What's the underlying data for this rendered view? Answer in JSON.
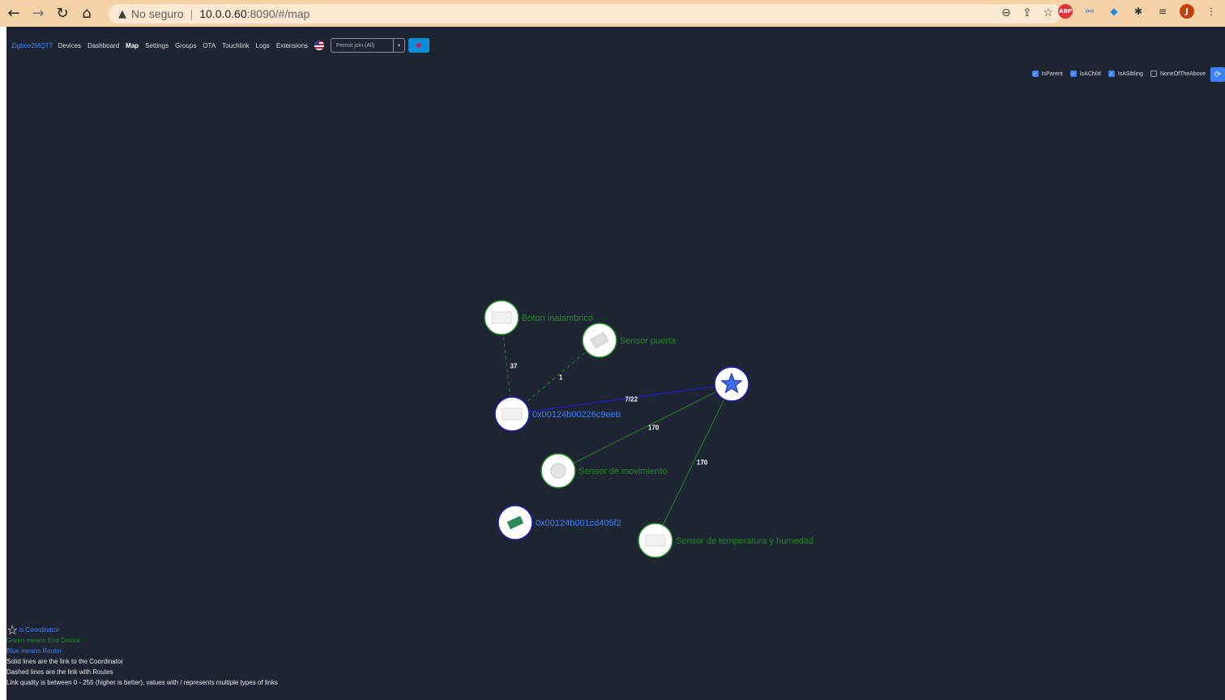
{
  "browser": {
    "back_icon": "arrow-left-icon",
    "forward_icon": "arrow-right-icon",
    "reload_icon": "reload-icon",
    "home_icon": "home-icon",
    "security_text": "No seguro",
    "url_host": "10.0.0.60",
    "url_path": ":8090/#/map",
    "profile_initial": "J"
  },
  "nav": {
    "brand": "Zigbee2MQTT",
    "items": [
      "Devices",
      "Dashboard",
      "Map",
      "Settings",
      "Groups",
      "OTA",
      "Touchlink",
      "Logs",
      "Extensions"
    ],
    "active": "Map",
    "permit_join": "Permit join (All)"
  },
  "filters": [
    {
      "label": "IsParent",
      "checked": true
    },
    {
      "label": "IsAChild",
      "checked": true
    },
    {
      "label": "IsASibling",
      "checked": true
    },
    {
      "label": "NoneOfTheAbove",
      "checked": false
    }
  ],
  "map": {
    "nodes": [
      {
        "id": "coordinator",
        "label": "",
        "type": "Coordinator"
      },
      {
        "id": "boton",
        "label": "Boton inalambrico",
        "type": "EndDevice"
      },
      {
        "id": "puerta",
        "label": "Sensor puerta",
        "type": "EndDevice"
      },
      {
        "id": "router1",
        "label": "0x00124b00226c9eeb",
        "type": "Router"
      },
      {
        "id": "movimiento",
        "label": "Sensor de movimiento",
        "type": "EndDevice"
      },
      {
        "id": "router2",
        "label": "0x00124b001cd405f2",
        "type": "Router"
      },
      {
        "id": "temperatura",
        "label": "Sensor de temperatura y humedad",
        "type": "EndDevice"
      }
    ],
    "links": [
      {
        "from": "router1",
        "to": "coordinator",
        "label": "7/22",
        "style": "solid",
        "kind": "router"
      },
      {
        "from": "movimiento",
        "to": "coordinator",
        "label": "170",
        "style": "solid",
        "kind": "end"
      },
      {
        "from": "temperatura",
        "to": "coordinator",
        "label": "170",
        "style": "solid",
        "kind": "end"
      },
      {
        "from": "boton",
        "to": "router1",
        "label": "37",
        "style": "dashed",
        "kind": "end"
      },
      {
        "from": "puerta",
        "to": "router1",
        "label": "1",
        "style": "dashed",
        "kind": "end"
      }
    ]
  },
  "legend": {
    "coordinator": "is Coordinator",
    "green": "Green means End Device",
    "blue": "Blue means Router",
    "solid": "Solid lines are the link to the Coordinator",
    "dashed": "Dashed lines are the link with Routes",
    "quality": "Link quality is between 0 - 255 (higher is better), values with / represents multiple types of links"
  },
  "colors": {
    "background": "#1f2433",
    "end_device": "#1f8a1f",
    "router": "#3b82f6",
    "coordinator_link": "#1e1eb4"
  }
}
